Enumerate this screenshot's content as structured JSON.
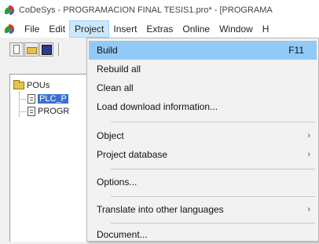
{
  "window": {
    "title": "CoDeSys - PROGRAMACION FINAL TESIS1.pro* - [PROGRAMA"
  },
  "menubar": {
    "items": [
      {
        "label": "File",
        "active": false
      },
      {
        "label": "Edit",
        "active": false
      },
      {
        "label": "Project",
        "active": true
      },
      {
        "label": "Insert",
        "active": false
      },
      {
        "label": "Extras",
        "active": false
      },
      {
        "label": "Online",
        "active": false
      },
      {
        "label": "Window",
        "active": false
      },
      {
        "label": "H",
        "active": false
      }
    ]
  },
  "toolbar": {
    "icons": [
      "new-file-icon",
      "open-folder-icon",
      "save-disk-icon"
    ]
  },
  "tree": {
    "root": {
      "label": "POUs"
    },
    "children": [
      {
        "label": "PLC_P",
        "selected": true
      },
      {
        "label": "PROGR",
        "selected": false
      }
    ]
  },
  "project_menu": {
    "build": {
      "label": "Build",
      "shortcut": "F11"
    },
    "rebuild_all": {
      "label": "Rebuild all"
    },
    "clean_all": {
      "label": "Clean all"
    },
    "load_download_info": {
      "label": "Load download information..."
    },
    "object": {
      "label": "Object"
    },
    "project_database": {
      "label": "Project database"
    },
    "options": {
      "label": "Options..."
    },
    "translate": {
      "label": "Translate into other languages"
    },
    "document": {
      "label": "Document..."
    }
  },
  "colors": {
    "menu_highlight": "#91c9f7",
    "active_menu": "#cce8ff",
    "tree_selection": "#3a6fd8"
  }
}
